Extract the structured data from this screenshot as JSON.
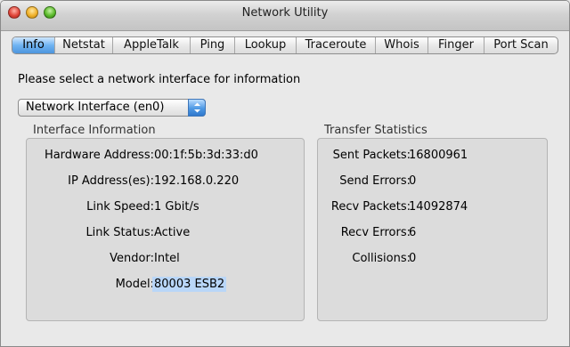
{
  "window": {
    "title": "Network Utility"
  },
  "tabs": [
    {
      "label": "Info",
      "active": true
    },
    {
      "label": "Netstat",
      "active": false
    },
    {
      "label": "AppleTalk",
      "active": false
    },
    {
      "label": "Ping",
      "active": false
    },
    {
      "label": "Lookup",
      "active": false
    },
    {
      "label": "Traceroute",
      "active": false
    },
    {
      "label": "Whois",
      "active": false
    },
    {
      "label": "Finger",
      "active": false
    },
    {
      "label": "Port Scan",
      "active": false
    }
  ],
  "prompt": "Please select a network interface for information",
  "interface_popup": {
    "selected": "Network Interface (en0)"
  },
  "interface_info": {
    "heading": "Interface Information",
    "hardware_address": {
      "label": "Hardware Address:",
      "value": "00:1f:5b:3d:33:d0"
    },
    "ip_addresses": {
      "label": "IP Address(es):",
      "value": "192.168.0.220"
    },
    "link_speed": {
      "label": "Link Speed:",
      "value": "1 Gbit/s"
    },
    "link_status": {
      "label": "Link Status:",
      "value": "Active"
    },
    "vendor": {
      "label": "Vendor:",
      "value": "Intel"
    },
    "model": {
      "label": "Model:",
      "value": "80003 ESB2"
    }
  },
  "transfer_stats": {
    "heading": "Transfer Statistics",
    "sent_packets": {
      "label": "Sent Packets:",
      "value": "16800961"
    },
    "send_errors": {
      "label": "Send Errors:",
      "value": "0"
    },
    "recv_packets": {
      "label": "Recv Packets:",
      "value": "14092874"
    },
    "recv_errors": {
      "label": "Recv Errors:",
      "value": "6"
    },
    "collisions": {
      "label": "Collisions:",
      "value": "0"
    }
  },
  "colors": {
    "selected_tab": "#4d95dd",
    "selection_highlight": "#b9d6f8"
  }
}
